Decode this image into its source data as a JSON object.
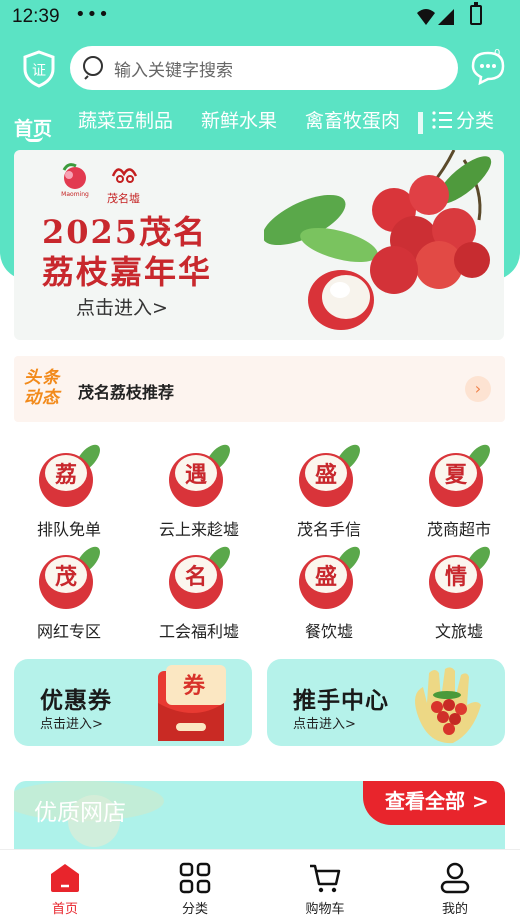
{
  "status_bar": {
    "time": "12:39",
    "dots": "•••"
  },
  "header": {
    "shield_text": "证",
    "search_placeholder": "输入关键字搜索",
    "message_count": "0"
  },
  "tabs": {
    "items": [
      {
        "label": "首页",
        "active": true
      },
      {
        "label": "蔬菜豆制品",
        "active": false
      },
      {
        "label": "新鲜水果",
        "active": false
      },
      {
        "label": "禽畜牧蛋肉",
        "active": false
      }
    ],
    "category_label": "分类"
  },
  "banner": {
    "logo_text": "茂名墟",
    "title_line1": "2025茂名",
    "title_line2": "荔枝嘉年华",
    "subtitle": "点击进入>"
  },
  "news": {
    "logo_line1": "头条",
    "logo_line2": "动态",
    "text": "茂名荔枝推荐",
    "arrow": "›"
  },
  "grid": [
    {
      "char": "荔",
      "label": "排队免单"
    },
    {
      "char": "遇",
      "label": "云上来趁墟"
    },
    {
      "char": "盛",
      "label": "茂名手信"
    },
    {
      "char": "夏",
      "label": "茂商超市"
    },
    {
      "char": "茂",
      "label": "网红专区"
    },
    {
      "char": "名",
      "label": "工会福利墟"
    },
    {
      "char": "盛",
      "label": "餐饮墟"
    },
    {
      "char": "情",
      "label": "文旅墟"
    }
  ],
  "cards": {
    "coupon": {
      "title": "优惠券",
      "subtitle": "点击进入>",
      "badge": "券"
    },
    "promoter": {
      "title": "推手中心",
      "subtitle": "点击进入>"
    }
  },
  "shop": {
    "title": "优质网店",
    "view_all": "查看全部 >"
  },
  "bottom_nav": [
    {
      "label": "首页",
      "icon": "home-icon",
      "active": true
    },
    {
      "label": "分类",
      "icon": "grid-icon",
      "active": false
    },
    {
      "label": "购物车",
      "icon": "cart-icon",
      "active": false
    },
    {
      "label": "我的",
      "icon": "user-icon",
      "active": false
    }
  ],
  "colors": {
    "accent": "#5be3c4",
    "red": "#e8252c",
    "card_bg": "#b5f2ea"
  }
}
